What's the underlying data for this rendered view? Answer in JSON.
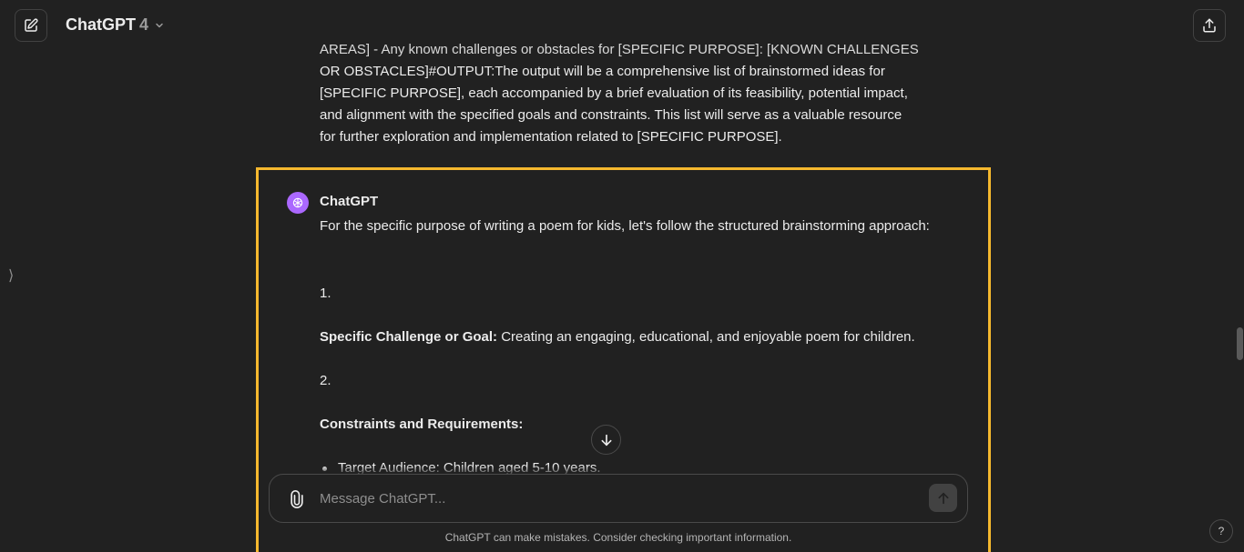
{
  "header": {
    "model_name": "ChatGPT",
    "model_version": "4"
  },
  "conversation": {
    "user_message_lines": [
      "AREAS] - Any known challenges or obstacles for [SPECIFIC PURPOSE]: [KNOWN CHALLENGES",
      "OR OBSTACLES]#OUTPUT:The output will be a comprehensive list of brainstormed ideas for",
      "[SPECIFIC PURPOSE], each accompanied by a brief evaluation of its feasibility, potential impact,",
      "and alignment with the specified goals and constraints. This list will serve as a valuable resource",
      "for further exploration and implementation related to [SPECIFIC PURPOSE]."
    ],
    "assistant": {
      "author": "ChatGPT",
      "intro": "For the specific purpose of writing a poem for kids, let's follow the structured brainstorming approach:",
      "item1_number": "1.",
      "item1_label": "Specific Challenge or Goal:",
      "item1_text": " Creating an engaging, educational, and enjoyable poem for children.",
      "item2_number": "2.",
      "item2_label": "Constraints and Requirements:",
      "bullet1": "Target Audience: Children aged 5-10 years."
    }
  },
  "composer": {
    "placeholder": "Message ChatGPT..."
  },
  "footer": {
    "disclaimer": "ChatGPT can make mistakes. Consider checking important information.",
    "help_label": "?"
  },
  "side_toggle": "⟩",
  "colors": {
    "background": "#212121",
    "highlight": "#f5b82e",
    "avatar": "#ab68ff"
  }
}
